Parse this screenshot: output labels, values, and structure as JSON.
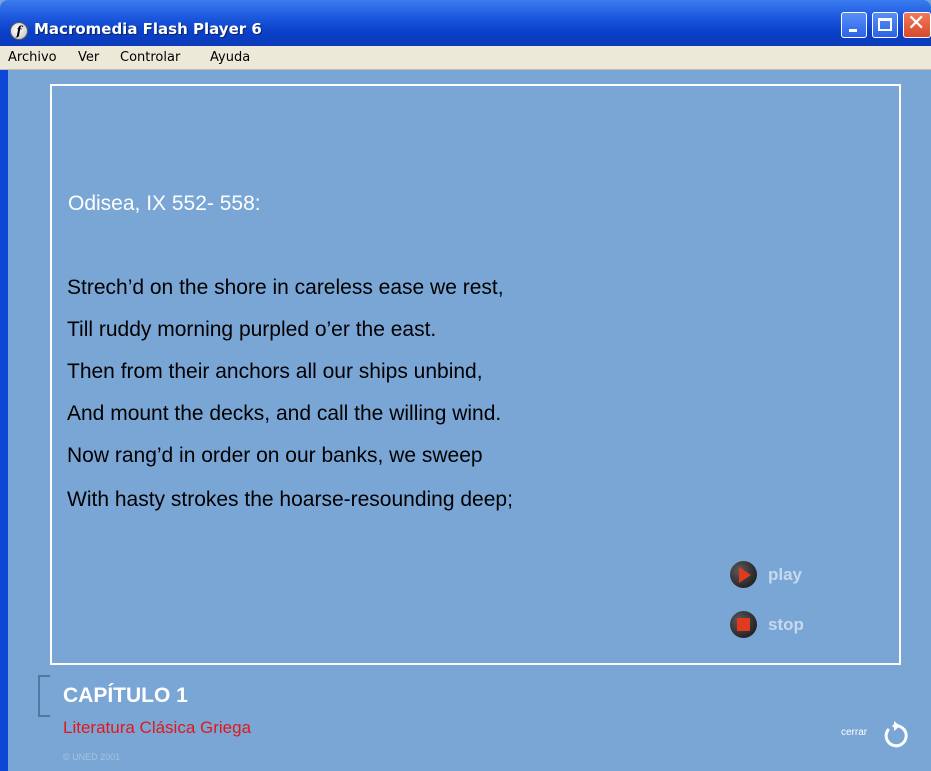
{
  "window": {
    "title": "Macromedia Flash Player 6",
    "app_icon": "f",
    "buttons": [
      "minimize-icon",
      "maximize-icon",
      "close-icon"
    ]
  },
  "menu": {
    "items": [
      "Archivo",
      "Ver",
      "Controlar",
      "Ayuda"
    ]
  },
  "content": {
    "reference": "Odisea, IX 552- 558:",
    "lines": [
      "Strech’d on the shore in careless ease we rest,",
      "Till ruddy morning purpled o’er the east.",
      "Then from their anchors all our ships unbind,",
      "And mount the decks, and call the willing wind.",
      "Now rang’d in order on our banks, we sweep",
      "With hasty strokes the hoarse-resounding deep;"
    ],
    "controls": {
      "play_label": "play",
      "stop_label": "stop"
    }
  },
  "footer": {
    "chapter": "CAPÍTULO 1",
    "subtitle": "Literatura Clásica Griega",
    "copyright": "© UNED 2001",
    "close_label": "cerrar"
  },
  "colors": {
    "background": "#7aa6d6",
    "accent_red": "#e0181a",
    "titlebar_blue": "#0b3bb9"
  }
}
